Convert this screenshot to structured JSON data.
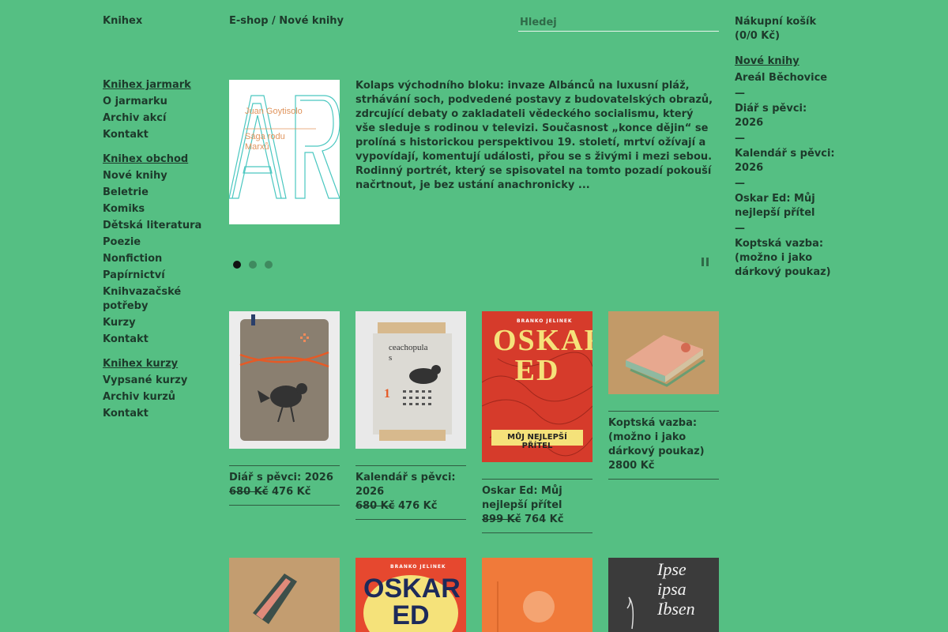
{
  "header": {
    "logo": "Knihex",
    "breadcrumb": "E-shop / Nové knihy",
    "search_placeholder": "Hledej"
  },
  "nav": {
    "groups": [
      {
        "title": "Knihex jarmark",
        "items": [
          "O jarmarku",
          "Archiv akcí",
          "Kontakt"
        ]
      },
      {
        "title": "Knihex obchod",
        "items": [
          "Nové knihy",
          "Beletrie",
          "Komiks",
          "Dětská literatura",
          "Poezie",
          "Nonfiction",
          "Papírnictví",
          "Knihvazačské potřeby",
          "Kurzy",
          "Kontakt"
        ]
      },
      {
        "title": "Knihex kurzy",
        "items": [
          "Vypsané kurzy",
          "Archiv kurzů",
          "Kontakt"
        ]
      }
    ]
  },
  "cart": {
    "title": "Nákupní košík",
    "total": "(0/0 Kč)",
    "section_title": "Nové knihy",
    "items": [
      "Areál Běchovice",
      "Diář s pěvci: 2026",
      "Kalendář s pěvci: 2026",
      "Oskar Ed: Můj nejlepší přítel",
      "Koptská vazba: (možno i jako dárkový poukaz)"
    ],
    "separator": "—"
  },
  "slider": {
    "cover_author": "Juan Goytisolo",
    "cover_title": "Sága rodu Marxů",
    "text": "Kolaps východního bloku: invaze Albánců na luxusní pláž, strhávání soch, podvedené postavy z budovatelských obrazů, zdrcující debaty o zakladateli vědeckého socialismu, který vše sleduje s rodinou v televizi. Současnost „konce dějin“ se prolíná s historickou perspektivou 19. století, mrtví ožívají a vypovídají, komentují události, přou se s živými i mezi sebou. Rodinný portrét, který se spisovatel na tomto pozadí pokouší načrtnout, je bez ustání anachronicky ...",
    "dots_count": 3,
    "active_dot": 0
  },
  "products": [
    {
      "title": "Diář s pěvci: 2026",
      "old_price": "680 Kč",
      "price": "476 Kč"
    },
    {
      "title": "Kalendář s pěvci: 2026",
      "old_price": "680 Kč",
      "price": "476 Kč"
    },
    {
      "title": "Oskar Ed: Můj nejlepší přítel",
      "old_price": "899 Kč",
      "price": "764 Kč",
      "cover_title": "OSKAR ED",
      "cover_subtitle": "MŮJ NEJLEPŠÍ PŘÍTEL",
      "cover_author": "BRANKO JELINEK"
    },
    {
      "title": "Koptská vazba: (možno i jako dárkový poukaz)",
      "old_price": "",
      "price": "2800 Kč"
    }
  ],
  "products_row2": [
    {
      "cover_title": ""
    },
    {
      "cover_title": "OSKAR ED",
      "cover_author": "BRANKO JELINEK"
    },
    {
      "cover_title": ""
    },
    {
      "cover_title": "Ipse ipsa Ibsen"
    }
  ],
  "calendar_cover": {
    "word": "ceachopulas",
    "month_number": "1"
  },
  "colors": {
    "background": "#55bf83",
    "text": "#1d3a2b",
    "oskar_red": "#d63b2b",
    "orange": "#f07a3a"
  }
}
